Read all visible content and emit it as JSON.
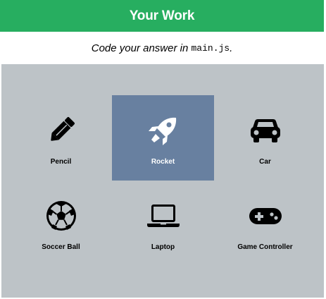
{
  "header": {
    "title": "Your Work"
  },
  "instructions": {
    "prefix": "Code your answer in ",
    "filename": "main.js",
    "suffix": "."
  },
  "tiles": [
    {
      "label": "Pencil",
      "icon": "pencil-icon",
      "selected": false
    },
    {
      "label": "Rocket",
      "icon": "rocket-icon",
      "selected": true
    },
    {
      "label": "Car",
      "icon": "car-icon",
      "selected": false
    },
    {
      "label": "Soccer Ball",
      "icon": "soccer-ball-icon",
      "selected": false
    },
    {
      "label": "Laptop",
      "icon": "laptop-icon",
      "selected": false
    },
    {
      "label": "Game Controller",
      "icon": "game-controller-icon",
      "selected": false
    }
  ],
  "colors": {
    "header_bg": "#27ae60",
    "grid_bg": "#bdc3c7",
    "selected_bg": "#6880a0"
  }
}
